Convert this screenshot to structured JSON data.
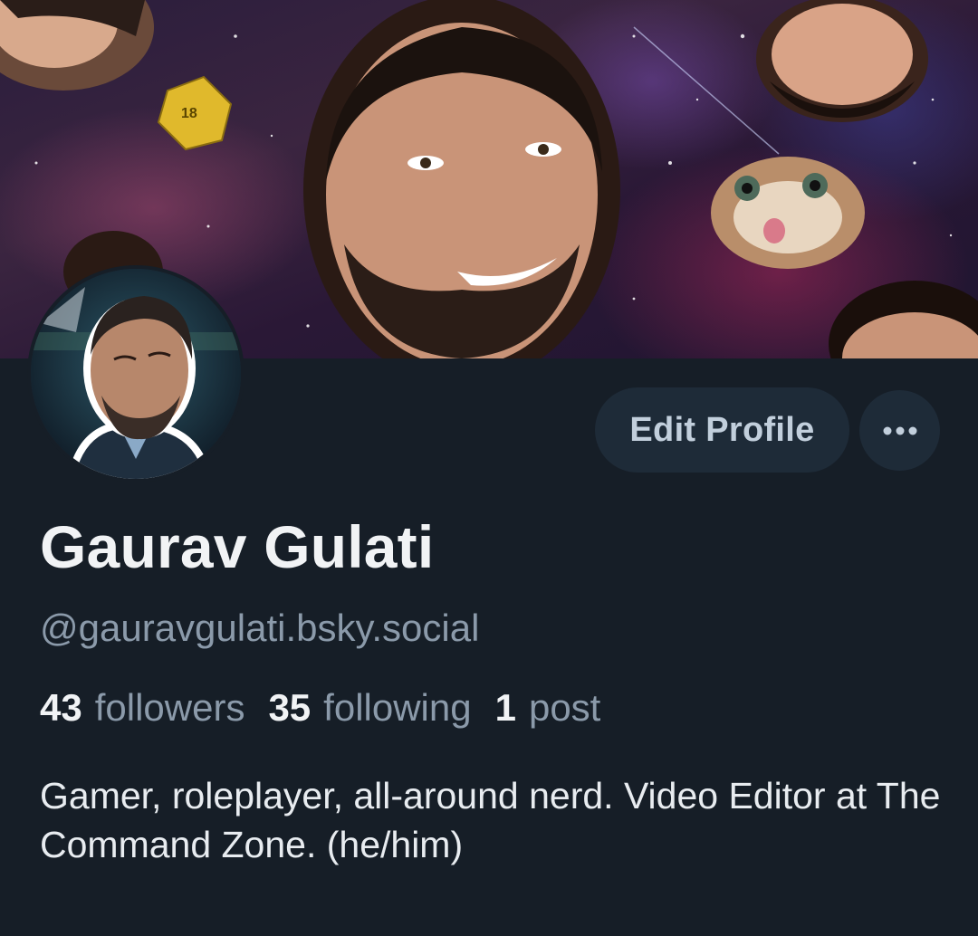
{
  "profile": {
    "display_name": "Gaurav Gulati",
    "handle": "@gauravgulati.bsky.social",
    "bio": "Gamer, roleplayer, all-around nerd. Video Editor at The Command Zone. (he/him)",
    "stats": {
      "followers_count": "43",
      "followers_label": "followers",
      "following_count": "35",
      "following_label": "following",
      "posts_count": "1",
      "posts_label": "post"
    }
  },
  "actions": {
    "edit_profile_label": "Edit Profile",
    "more_icon": "ellipsis-icon"
  },
  "colors": {
    "background": "#161e27",
    "button_bg": "#1e2b38",
    "muted_text": "#8b9aaa",
    "primary_text": "#f1f3f5"
  }
}
